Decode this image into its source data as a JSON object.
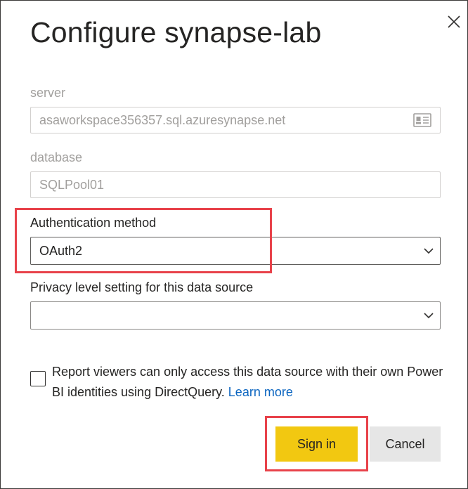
{
  "dialog": {
    "title": "Configure synapse-lab"
  },
  "server": {
    "label": "server",
    "value": "asaworkspace356357.sql.azuresynapse.net"
  },
  "database": {
    "label": "database",
    "value": "SQLPool01"
  },
  "auth": {
    "label": "Authentication method",
    "value": "OAuth2"
  },
  "privacy": {
    "label": "Privacy level setting for this data source",
    "value": ""
  },
  "consent": {
    "text": "Report viewers can only access this data source with their own Power BI identities using DirectQuery.",
    "link": "Learn more",
    "checked": false
  },
  "buttons": {
    "sign_in": "Sign in",
    "cancel": "Cancel"
  },
  "colors": {
    "highlight": "#e8424a",
    "primary": "#f2c811",
    "link": "#0b65c0"
  },
  "icons": {
    "close": "close-icon",
    "chevron": "chevron-down-icon",
    "card": "contact-card-icon"
  }
}
